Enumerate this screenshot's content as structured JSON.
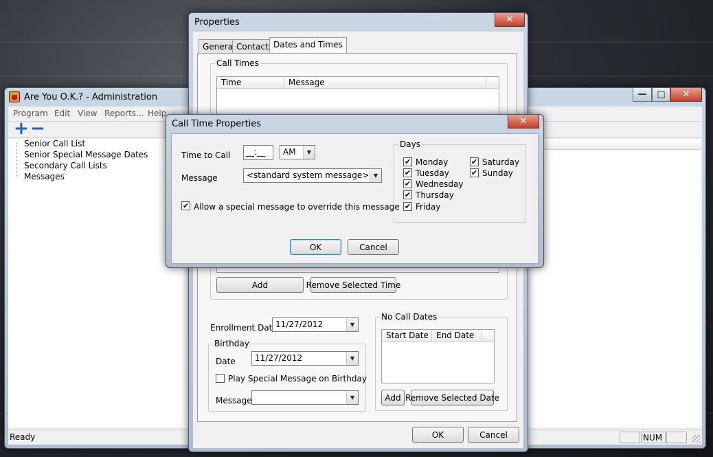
{
  "admin": {
    "title": "Are You O.K.? - Administration",
    "menu": [
      "Program",
      "Edit",
      "View",
      "Reports...",
      "Help"
    ],
    "tree": [
      "Senior Call List",
      "Senior Special Message Dates",
      "Secondary Call Lists",
      "Messages"
    ],
    "status": {
      "ready": "Ready",
      "num": "NUM"
    },
    "controls": {
      "minimize": "—",
      "maximize": "□",
      "close": "✕"
    },
    "toolbar": {
      "add": "+",
      "remove": "−"
    }
  },
  "properties": {
    "title": "Properties",
    "close": "✕",
    "tabs": [
      "General",
      "Contacts",
      "Dates and Times"
    ],
    "call_times": {
      "label": "Call Times",
      "columns": [
        "Time",
        "Message"
      ],
      "add": "Add",
      "remove": "Remove Selected Time"
    },
    "enrollment": {
      "label": "Enrollment Date",
      "value": "11/27/2012"
    },
    "birthday": {
      "label": "Birthday",
      "date_label": "Date",
      "date_value": "11/27/2012",
      "play_special": "Play Special Message on Birthday",
      "message_label": "Message",
      "message_value": ""
    },
    "no_call": {
      "label": "No Call Dates",
      "columns": [
        "Start Date",
        "End Date"
      ],
      "add": "Add",
      "remove": "Remove Selected Date"
    },
    "ok": "OK",
    "cancel": "Cancel"
  },
  "call_time": {
    "title": "Call Time Properties",
    "close": "✕",
    "time_label": "Time to Call",
    "time_value": "__:__",
    "ampm": "AM",
    "message_label": "Message",
    "message_value": "<standard system message>",
    "override": "Allow a special message to override this message",
    "days_label": "Days",
    "days": [
      {
        "name": "Monday",
        "checked": true
      },
      {
        "name": "Tuesday",
        "checked": true
      },
      {
        "name": "Wednesday",
        "checked": true
      },
      {
        "name": "Thursday",
        "checked": true
      },
      {
        "name": "Friday",
        "checked": true
      },
      {
        "name": "Saturday",
        "checked": true
      },
      {
        "name": "Sunday",
        "checked": true
      }
    ],
    "check_mark": "✔",
    "ok": "OK",
    "cancel": "Cancel"
  },
  "colors": {
    "accent": "#1e5fd0",
    "close_red": "#c3402a"
  }
}
